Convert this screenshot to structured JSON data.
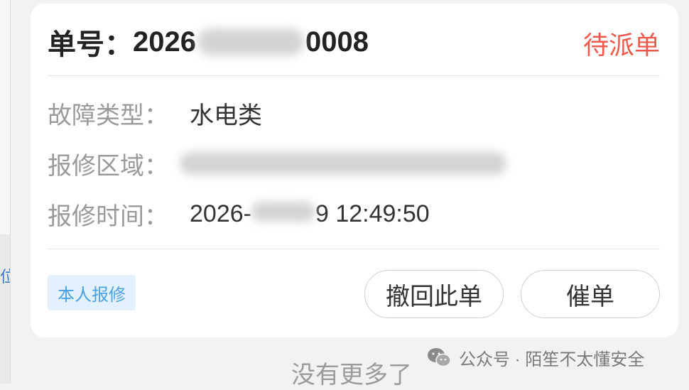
{
  "order": {
    "label": "单号：",
    "number_start": "2026",
    "number_end": "0008",
    "status": "待派单"
  },
  "details": {
    "fault_type": {
      "label": "故障类型：",
      "value": "水电类"
    },
    "area": {
      "label": "报修区域："
    },
    "time": {
      "label": "报修时间：",
      "value_start": "2026",
      "value_mid": "-",
      "value_end": "9 12:49:50"
    }
  },
  "footer": {
    "tag": "本人报修",
    "revoke_button": "撤回此单",
    "urge_button": "催单"
  },
  "page": {
    "no_more": "没有更多了",
    "left_edge_text": "位"
  },
  "watermark": {
    "text": "公众号 · 陌笙不太懂安全"
  },
  "colors": {
    "status": "#f0584c",
    "tag_text": "#4aa1e6",
    "tag_bg": "#e2f1fd"
  }
}
